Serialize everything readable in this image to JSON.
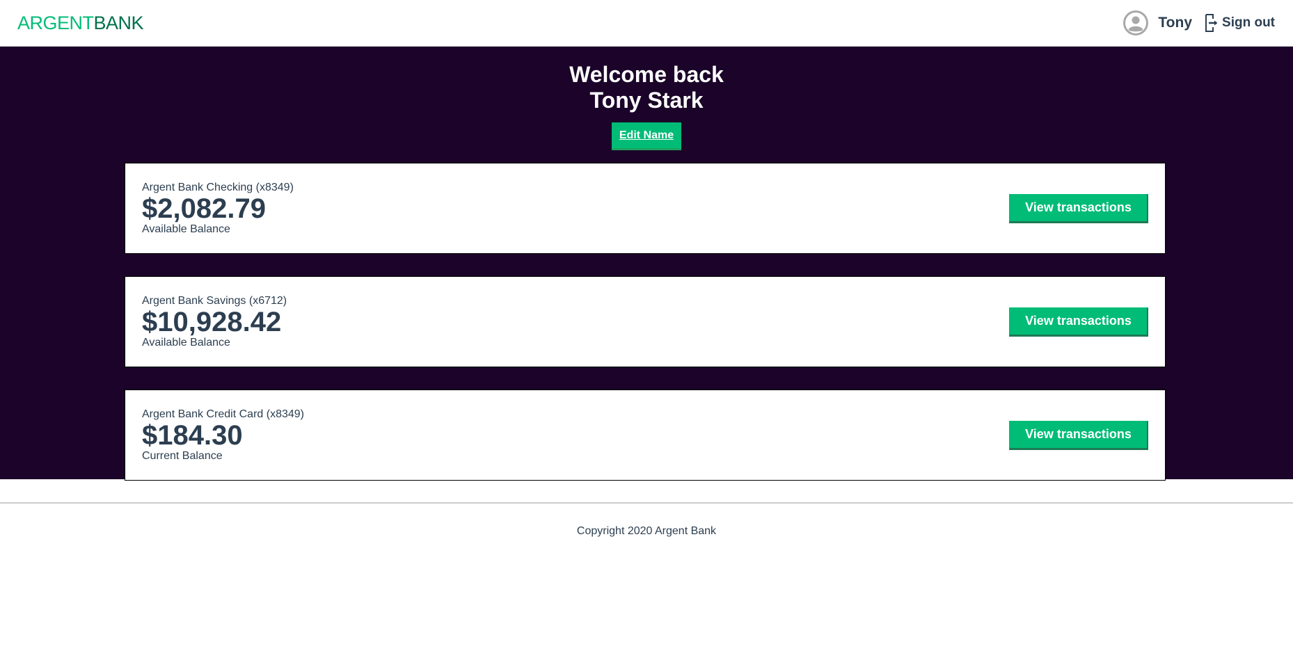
{
  "nav": {
    "logo_part1": "ARGENT",
    "logo_part2": "BANK",
    "user_name": "Tony",
    "signout_label": "Sign out"
  },
  "header": {
    "line1": "Welcome back",
    "line2": "Tony Stark",
    "edit_button_label": "Edit Name"
  },
  "accounts": [
    {
      "title": "Argent Bank Checking (x8349)",
      "amount": "$2,082.79",
      "description": "Available Balance",
      "button_label": "View transactions"
    },
    {
      "title": "Argent Bank Savings (x6712)",
      "amount": "$10,928.42",
      "description": "Available Balance",
      "button_label": "View transactions"
    },
    {
      "title": "Argent Bank Credit Card (x8349)",
      "amount": "$184.30",
      "description": "Current Balance",
      "button_label": "View transactions"
    }
  ],
  "footer": {
    "text": "Copyright 2020 Argent Bank"
  },
  "icons": {
    "user": "user-circle-icon",
    "signout": "sign-out-icon"
  },
  "colors": {
    "brand_green": "#00bc77",
    "brand_dark_green": "#00704a",
    "background_dark": "#1b0329",
    "text": "#2c3e50"
  }
}
